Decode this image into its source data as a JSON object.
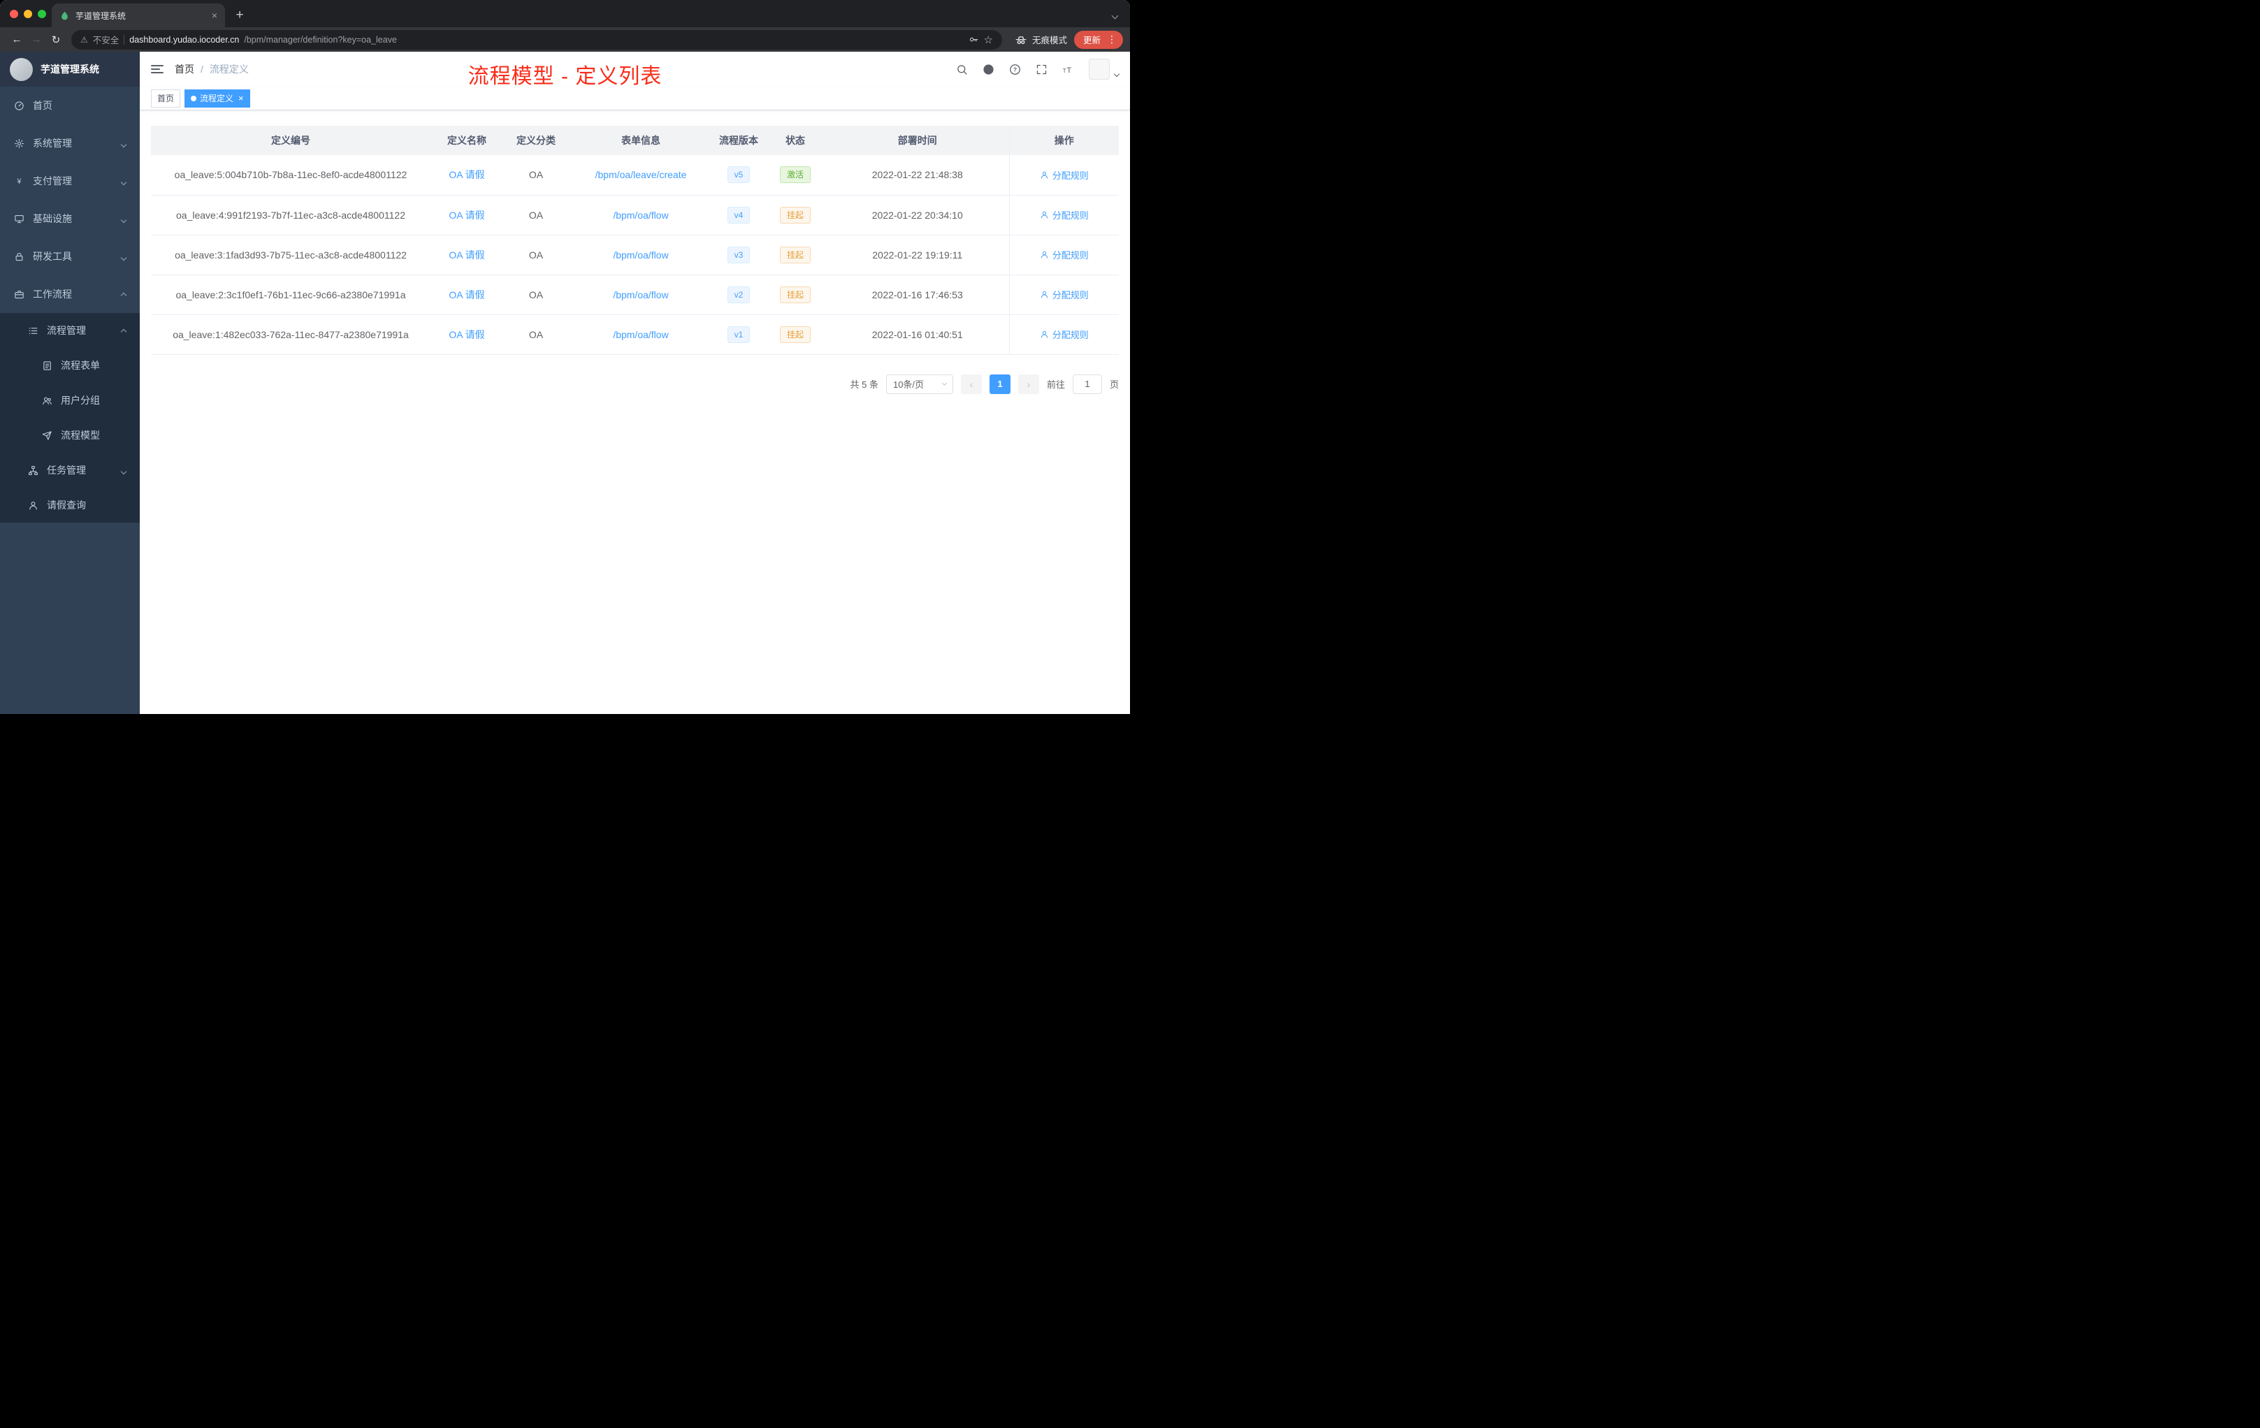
{
  "colors": {
    "accent": "#409eff",
    "annotation_red": "#fa2c19",
    "sidebar_bg": "#304156",
    "submenu_bg": "#1f2d3d"
  },
  "browser": {
    "tab_title": "芋道管理系统",
    "security_label": "不安全",
    "url_host": "dashboard.yudao.iocoder.cn",
    "url_path": "/bpm/manager/definition?key=oa_leave",
    "incognito_label": "无痕模式",
    "update_label": "更新",
    "glyphs": {
      "back": "←",
      "forward": "→",
      "reload": "↻",
      "warning": "⚠",
      "star": "☆",
      "menu_dots": "⋮",
      "tab_close": "×",
      "new_tab": "+"
    }
  },
  "sidebar": {
    "logo_title": "芋道管理系统",
    "items": [
      {
        "key": "home",
        "label": "首页",
        "icon": "dashboard-icon",
        "level": 1
      },
      {
        "key": "system-mgmt",
        "label": "系统管理",
        "icon": "gear-icon",
        "level": 1,
        "expandable": true
      },
      {
        "key": "payment-mgmt",
        "label": "支付管理",
        "icon": "yen-icon",
        "level": 1,
        "expandable": true
      },
      {
        "key": "infrastructure",
        "label": "基础设施",
        "icon": "monitor-icon",
        "level": 1,
        "expandable": true
      },
      {
        "key": "dev-tools",
        "label": "研发工具",
        "icon": "lock-icon",
        "level": 1,
        "expandable": true
      },
      {
        "key": "workflow",
        "label": "工作流程",
        "icon": "briefcase-icon",
        "level": 1,
        "expandable": true,
        "expanded": true
      },
      {
        "key": "process-mgmt",
        "label": "流程管理",
        "icon": "list-icon",
        "level": 2,
        "expandable": true,
        "expanded": true
      },
      {
        "key": "process-form",
        "label": "流程表单",
        "icon": "form-icon",
        "level": 3
      },
      {
        "key": "user-group",
        "label": "用户分组",
        "icon": "users-icon",
        "level": 3
      },
      {
        "key": "process-model",
        "label": "流程模型",
        "icon": "send-icon",
        "level": 3
      },
      {
        "key": "task-mgmt",
        "label": "任务管理",
        "icon": "tree-icon",
        "level": 2,
        "expandable": true
      },
      {
        "key": "leave-query",
        "label": "请假查询",
        "icon": "user-icon",
        "level": 2
      }
    ]
  },
  "header": {
    "breadcrumb": [
      "首页",
      "流程定义"
    ],
    "breadcrumb_separator": "/",
    "annotation": "流程模型 - 定义列表",
    "action_icons": [
      "search-icon",
      "github-icon",
      "question-icon",
      "fullscreen-icon",
      "font-size-icon"
    ]
  },
  "tags": [
    {
      "label": "首页",
      "active": false,
      "closable": false
    },
    {
      "label": "流程定义",
      "active": true,
      "closable": true
    }
  ],
  "table": {
    "columns": [
      "定义编号",
      "定义名称",
      "定义分类",
      "表单信息",
      "流程版本",
      "状态",
      "部署时间",
      "操作"
    ],
    "rows": [
      {
        "id": "oa_leave:5:004b710b-7b8a-11ec-8ef0-acde48001122",
        "name": "OA 请假",
        "category": "OA",
        "form": "/bpm/oa/leave/create",
        "version": "v5",
        "status": "激活",
        "status_type": "success",
        "time": "2022-01-22 21:48:38",
        "action": "分配规则"
      },
      {
        "id": "oa_leave:4:991f2193-7b7f-11ec-a3c8-acde48001122",
        "name": "OA 请假",
        "category": "OA",
        "form": "/bpm/oa/flow",
        "version": "v4",
        "status": "挂起",
        "status_type": "warning",
        "time": "2022-01-22 20:34:10",
        "action": "分配规则"
      },
      {
        "id": "oa_leave:3:1fad3d93-7b75-11ec-a3c8-acde48001122",
        "name": "OA 请假",
        "category": "OA",
        "form": "/bpm/oa/flow",
        "version": "v3",
        "status": "挂起",
        "status_type": "warning",
        "time": "2022-01-22 19:19:11",
        "action": "分配规则"
      },
      {
        "id": "oa_leave:2:3c1f0ef1-76b1-11ec-9c66-a2380e71991a",
        "name": "OA 请假",
        "category": "OA",
        "form": "/bpm/oa/flow",
        "version": "v2",
        "status": "挂起",
        "status_type": "warning",
        "time": "2022-01-16 17:46:53",
        "action": "分配规则"
      },
      {
        "id": "oa_leave:1:482ec033-762a-11ec-8477-a2380e71991a",
        "name": "OA 请假",
        "category": "OA",
        "form": "/bpm/oa/flow",
        "version": "v1",
        "status": "挂起",
        "status_type": "warning",
        "time": "2022-01-16 01:40:51",
        "action": "分配规则"
      }
    ]
  },
  "pagination": {
    "total": "共 5 条",
    "page_size": "10条/页",
    "prev": "‹",
    "current_page": "1",
    "next": "›",
    "goto_label": "前往",
    "goto_value": "1",
    "goto_suffix": "页"
  }
}
